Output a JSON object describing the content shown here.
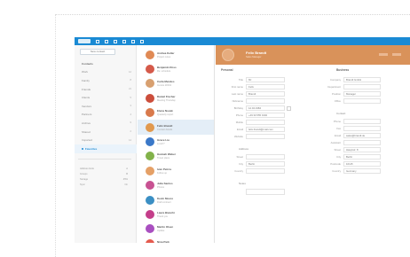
{
  "colors": {
    "topbar": "#1a8ad4",
    "banner": "#d9925a",
    "selected_row": "#e4eef7",
    "accent": "#1a8ad4"
  },
  "topbar": {
    "icons": [
      "mail-icon",
      "calendar-icon",
      "contacts-icon",
      "tasks-icon",
      "notes-icon",
      "settings-icon",
      "help-icon"
    ]
  },
  "sidebar": {
    "compose_label": "New contact",
    "folders": [
      {
        "label": "Contacts",
        "count": "",
        "head": true
      },
      {
        "label": "Work",
        "count": "12"
      },
      {
        "label": "Family",
        "count": "8"
      },
      {
        "label": "Friends",
        "count": "21"
      },
      {
        "label": "Clients",
        "count": "5"
      },
      {
        "label": "Vendors",
        "count": "3"
      },
      {
        "label": "Partners",
        "count": "4"
      },
      {
        "label": "Archive",
        "count": "9"
      },
      {
        "label": "Shared",
        "count": "2"
      },
      {
        "label": "Imported",
        "count": "14"
      },
      {
        "label": "Favorites",
        "count": "",
        "active": true
      }
    ],
    "footer": [
      {
        "label": "Address book",
        "value": "A"
      },
      {
        "label": "Groups",
        "value": "B"
      },
      {
        "label": "Storage",
        "value": "45%"
      },
      {
        "label": "Sync",
        "value": "On"
      }
    ]
  },
  "messages": [
    {
      "from": "Andrea Keller",
      "subject": "Project notes",
      "color": "#e08a55"
    },
    {
      "from": "Benjamin Ross",
      "subject": "Re: schedule",
      "color": "#d55a4a"
    },
    {
      "from": "Carla Mendes",
      "subject": "Invoice #2041",
      "color": "#d8a070"
    },
    {
      "from": "Daniel Fischer",
      "subject": "Meeting Thursday",
      "color": "#cc4e3c"
    },
    {
      "from": "Elena Novak",
      "subject": "Quarterly report",
      "color": "#d97a4c"
    },
    {
      "from": "Felix Brandt",
      "subject": "Contact details",
      "color": "#e1994e",
      "selected": true
    },
    {
      "from": "Grace Liu",
      "subject": "Lunch?",
      "color": "#3a78c8"
    },
    {
      "from": "Hannah Weber",
      "subject": "Travel plans",
      "color": "#82b24a"
    },
    {
      "from": "Ivan Petrov",
      "subject": "Follow up",
      "color": "#e5a066"
    },
    {
      "from": "Julia Santos",
      "subject": "Photos",
      "color": "#c85292"
    },
    {
      "from": "Kevin Moore",
      "subject": "Draft contract",
      "color": "#3b8fc4"
    },
    {
      "from": "Laura Bianchi",
      "subject": "Thank you",
      "color": "#c43e8a"
    },
    {
      "from": "Martin Olsen",
      "subject": "Update",
      "color": "#a94fc0"
    },
    {
      "from": "Nina Park",
      "subject": "Reminder",
      "color": "#e55a4e"
    }
  ],
  "contact": {
    "name": "Felix Brandt",
    "subtitle": "Sales Manager",
    "left": {
      "title": "Personal",
      "fields": [
        {
          "label": "Title",
          "value": "Mr."
        },
        {
          "label": "First name",
          "value": "Felix"
        },
        {
          "label": "Last name",
          "value": "Brandt"
        },
        {
          "label": "Nickname",
          "value": ""
        },
        {
          "label": "Birthday",
          "value": "12.04.1984"
        },
        {
          "label": "Phone",
          "value": "+49 30 555 0192"
        },
        {
          "label": "Mobile",
          "value": ""
        },
        {
          "label": "Email",
          "value": "felix.brandt@mail.com"
        },
        {
          "label": "Website",
          "value": ""
        }
      ],
      "sub_title": "Address",
      "address": [
        {
          "label": "Street",
          "value": ""
        },
        {
          "label": "City",
          "value": "Berlin"
        },
        {
          "label": "Country",
          "value": ""
        }
      ],
      "notes_title": "Notes",
      "notes_value": ""
    },
    "right": {
      "title": "Business",
      "fields": [
        {
          "label": "Company",
          "value": "Brandt GmbH"
        },
        {
          "label": "Department",
          "value": ""
        },
        {
          "label": "Position",
          "value": "Manager"
        },
        {
          "label": "Office",
          "value": ""
        }
      ],
      "sub_title": "Contact",
      "contact_fields": [
        {
          "label": "Phone",
          "value": ""
        },
        {
          "label": "Fax",
          "value": ""
        },
        {
          "label": "Email",
          "value": "sales@brandt.de"
        },
        {
          "label": "Assistant",
          "value": ""
        },
        {
          "label": "Street",
          "value": "Hauptstr. 8"
        },
        {
          "label": "City",
          "value": "Berlin"
        },
        {
          "label": "Postcode",
          "value": "10115"
        },
        {
          "label": "Country",
          "value": "Germany"
        }
      ]
    }
  }
}
